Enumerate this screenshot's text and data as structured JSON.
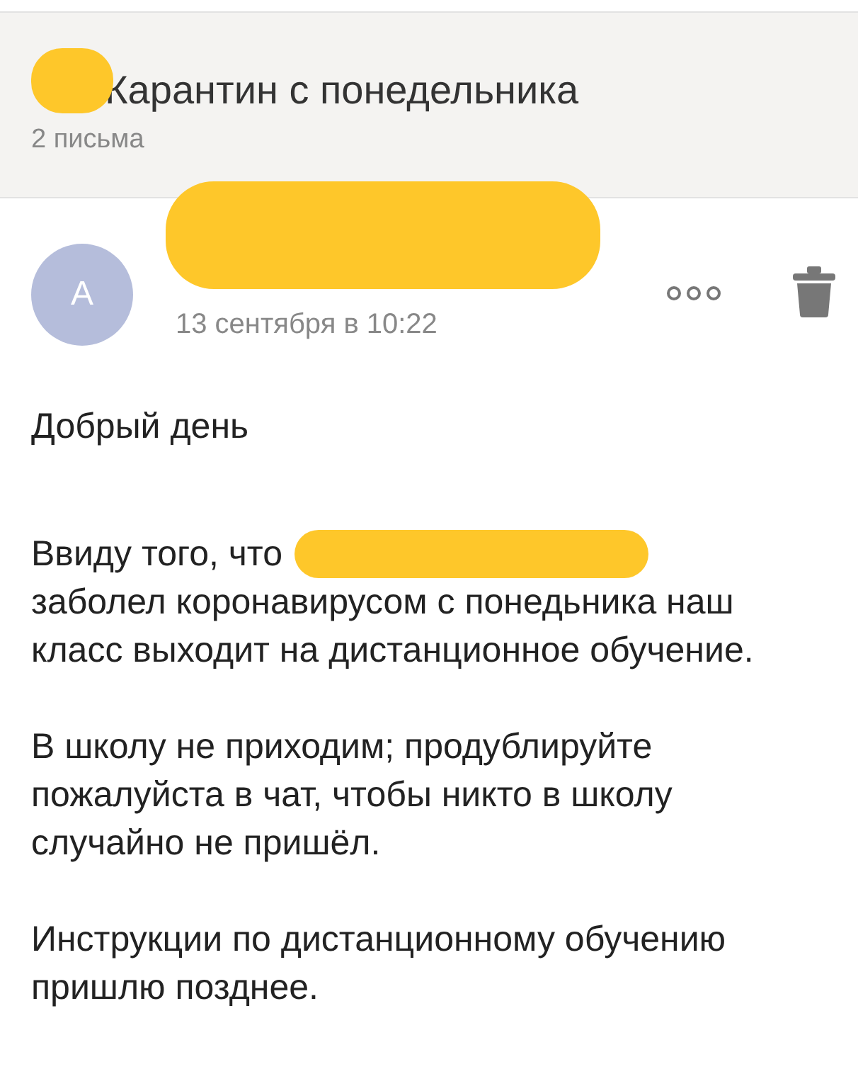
{
  "thread": {
    "subject": "Карантин с понедельника",
    "count": "2 письма"
  },
  "message": {
    "avatar_letter": "A",
    "date": "13 сентября в 10:22"
  },
  "body": {
    "greeting": "Добрый день",
    "lead": "Ввиду того, что",
    "paragraphs": [
      "заболел коронавирусом с понедьника наш класс выходит на дистанционное обучение.",
      "В школу не приходим; продублируйте пожалуйста в чат, чтобы никто в школу случайно не пришёл.",
      "Инструкции по дистанционному обучению пришлю позднее."
    ]
  }
}
